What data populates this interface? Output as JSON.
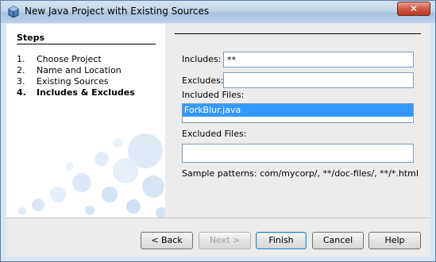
{
  "window": {
    "title": "New Java Project with Existing Sources",
    "close_label": "✕"
  },
  "steps": {
    "title": "Steps",
    "items": [
      {
        "num": "1.",
        "label": "Choose Project"
      },
      {
        "num": "2.",
        "label": "Name and Location"
      },
      {
        "num": "3.",
        "label": "Existing Sources"
      },
      {
        "num": "4.",
        "label": "Includes & Excludes"
      }
    ],
    "current_index": 3
  },
  "form": {
    "includes_label": "Includes:",
    "includes_value": "**",
    "excludes_label": "Excludes:",
    "excludes_value": "",
    "included_files_label": "Included Files:",
    "included_files": [
      "ForkBlur.java"
    ],
    "excluded_files_label": "Excluded Files:",
    "excluded_files": [],
    "sample_patterns": "Sample patterns: com/mycorp/, **/doc-files/, **/*.html"
  },
  "buttons": {
    "back": "< Back",
    "next": "Next >",
    "finish": "Finish",
    "cancel": "Cancel",
    "help": "Help"
  }
}
